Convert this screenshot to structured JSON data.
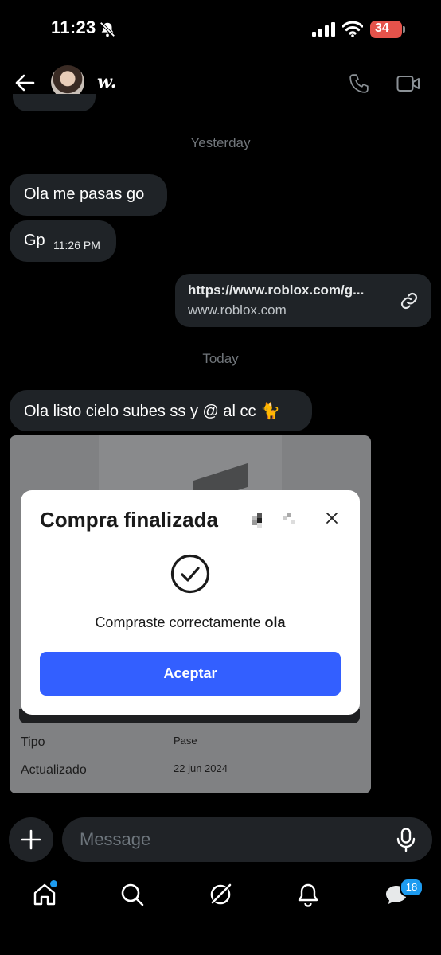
{
  "status": {
    "time": "11:23",
    "battery": "34"
  },
  "header": {
    "contact_name": "w."
  },
  "messages": {
    "separator_yesterday": "Yesterday",
    "msg1": "Ola me pasas go",
    "msg2": "Gp",
    "msg2_time": "11:26 PM",
    "link_url": "https://www.roblox.com/g...",
    "link_domain": "www.roblox.com",
    "separator_today": "Today",
    "msg3": "Ola listo cielo subes ss y @ al cc 🐈"
  },
  "shared_card": {
    "rows": [
      {
        "label": "Tipo",
        "value": "Pase"
      },
      {
        "label": "Actualizado",
        "value": "22 jun 2024"
      }
    ]
  },
  "modal": {
    "title": "Compra finalizada",
    "message_prefix": "Compraste correctamente ",
    "message_bold": "ola",
    "button_label": "Aceptar"
  },
  "composer": {
    "placeholder": "Message"
  },
  "nav": {
    "messages_badge": "18"
  },
  "colors": {
    "accent": "#335fff",
    "badge": "#1d9bf0",
    "bubble": "#1f2327"
  }
}
